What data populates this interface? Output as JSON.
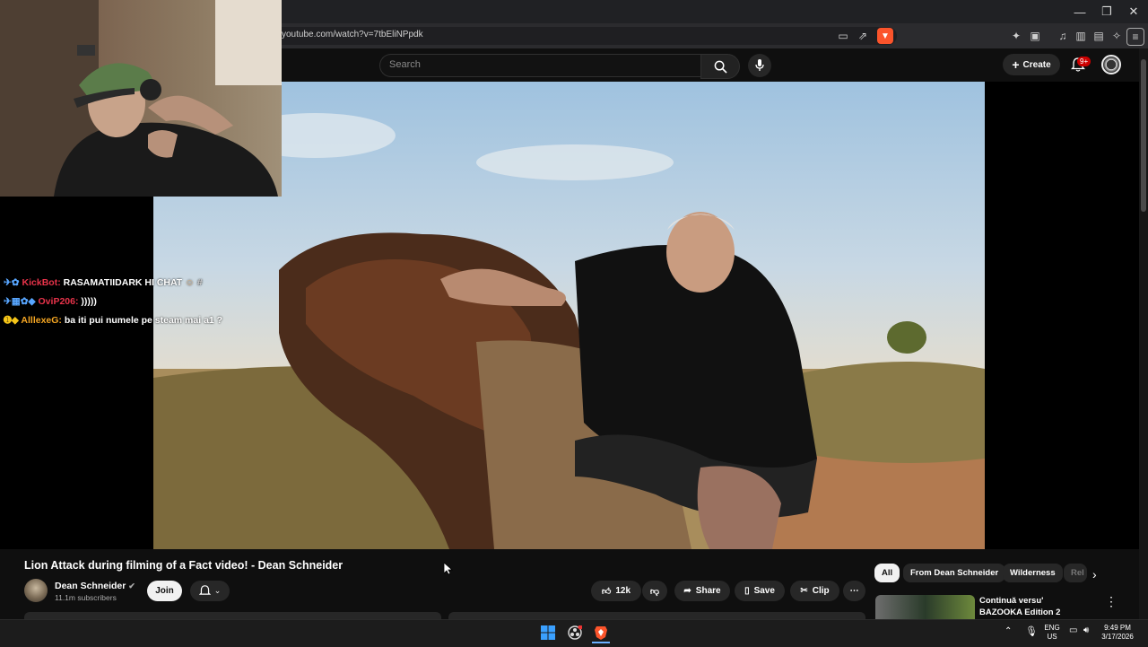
{
  "browser": {
    "url": "youtube.com/watch?v=7tbEliNPpdk"
  },
  "youtube": {
    "search_placeholder": "Search",
    "create_label": "Create",
    "notification_count": "9+"
  },
  "video": {
    "title": "Lion Attack during filming of a Fact video! - Dean Schneider",
    "channel": "Dean Schneider",
    "subscribers": "11.1m subscribers",
    "join_label": "Join",
    "likes": "12k",
    "share_label": "Share",
    "save_label": "Save",
    "clip_label": "Clip"
  },
  "chips": [
    "All",
    "From Dean Schneider",
    "Wilderness",
    "Rel"
  ],
  "recommendation": {
    "title": "Continuă versu' BAZOOKA Edition 2"
  },
  "chat": [
    {
      "user": "KickBot:",
      "user_color": "#e8334a",
      "message": "RASAMATIIDARK HI CHAT",
      "tail": "#"
    },
    {
      "user": "OviP206:",
      "user_color": "#e8334a",
      "message": ")))))",
      "tail": ""
    },
    {
      "user": "AlllexeG:",
      "user_color": "#f5a623",
      "message": "ba iti pui numele pe steam mai a1 ?",
      "tail": ""
    }
  ],
  "taskbar": {
    "lang_top": "ENG",
    "lang_bottom": "US",
    "time": "9:49 PM",
    "date": "3/17/2026"
  },
  "colors": {
    "background": "#0f0f0f",
    "accent_red": "#cc0000",
    "chip_active": "#f1f1f1"
  }
}
